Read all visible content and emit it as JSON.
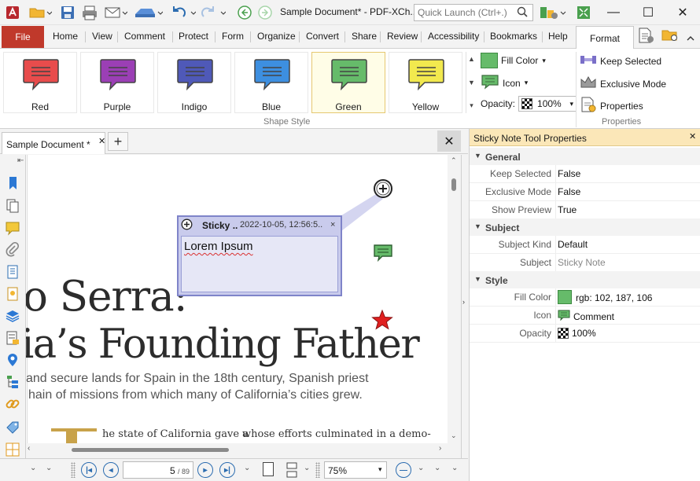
{
  "window": {
    "title": "Sample Document* - PDF-XCh...",
    "quick_launch_placeholder": "Quick Launch (Ctrl+.)",
    "controls": {
      "minimize": "—",
      "maximize": "☐",
      "close": "✕"
    }
  },
  "menubar": {
    "file": "File",
    "items": [
      "Home",
      "View",
      "Comment",
      "Protect",
      "Form",
      "Organize",
      "Convert",
      "Share",
      "Review",
      "Accessibility",
      "Bookmarks",
      "Help"
    ],
    "active_tab": "Format"
  },
  "ribbon": {
    "shape_styles": [
      {
        "label": "Red",
        "color": "#e84c4c"
      },
      {
        "label": "Purple",
        "color": "#9b3fb5"
      },
      {
        "label": "Indigo",
        "color": "#4f59b8"
      },
      {
        "label": "Blue",
        "color": "#3d8fe0"
      },
      {
        "label": "Green",
        "color": "#66bb6a"
      },
      {
        "label": "Yellow",
        "color": "#f2e94e"
      }
    ],
    "selected_style": "Green",
    "shape_style_group": "Shape Style",
    "fill_color_label": "Fill Color",
    "fill_color": "#66bb6a",
    "icon_label": "Icon",
    "opacity_label": "Opacity:",
    "opacity_value": "100%",
    "keep_selected": "Keep Selected",
    "exclusive_mode": "Exclusive Mode",
    "properties": "Properties",
    "properties_group": "Properties"
  },
  "document": {
    "tab_label": "Sample Document *",
    "heading_line1": "o Serra:",
    "heading_line2": "ia’s Founding Father",
    "subtext_line1": "and secure lands for Spain in the 18th century, Spanish priest",
    "subtext_line2": "hain of missions from which many of California’s cities grew.",
    "body_col1": "he state of California gave a",
    "body_col2": "whose efforts culminated in a demo-",
    "sticky_popup": {
      "title": "Sticky ..",
      "timestamp": "2022-10-05, 12:56:5..",
      "close": "×",
      "content": "Lorem Ipsum"
    }
  },
  "statusbar": {
    "page_current": "5",
    "page_total": "/ 89",
    "zoom": "75%"
  },
  "properties_panel": {
    "title": "Sticky Note Tool Properties",
    "sections": {
      "general": "General",
      "subject": "Subject",
      "style": "Style"
    },
    "rows": {
      "keep_selected": {
        "key": "Keep Selected",
        "value": "False"
      },
      "exclusive_mode": {
        "key": "Exclusive Mode",
        "value": "False"
      },
      "show_preview": {
        "key": "Show Preview",
        "value": "True"
      },
      "subject_kind": {
        "key": "Subject Kind",
        "value": "Default"
      },
      "subject": {
        "key": "Subject",
        "value": "Sticky Note"
      },
      "fill_color": {
        "key": "Fill Color",
        "value": "rgb: 102, 187, 106"
      },
      "icon": {
        "key": "Icon",
        "value": "Comment"
      },
      "opacity": {
        "key": "Opacity",
        "value": "100%"
      }
    }
  }
}
